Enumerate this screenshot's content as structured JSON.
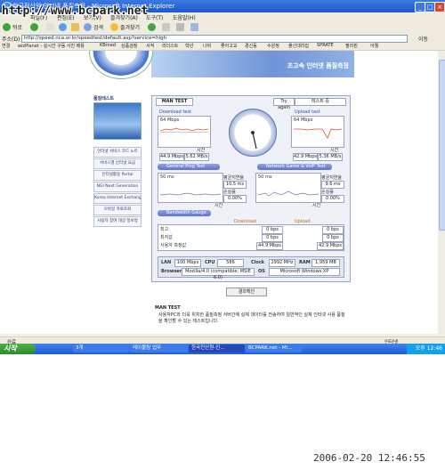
{
  "window": {
    "title": "한국전산원-인터넷 품질측정 - Microsoft Internet Explorer"
  },
  "watermark": "http://www.bcpark.net",
  "menu": [
    "파일(F)",
    "편집(E)",
    "보기(V)",
    "즐겨찾기(A)",
    "도구(T)",
    "도움말(H)"
  ],
  "toolbar": {
    "back": "뒤로",
    "search": "검색",
    "favorites": "즐겨찾기"
  },
  "address": {
    "label": "주소(D)",
    "url": "http://speed.nca.or.kr/speedtest/default.asp?service=high",
    "go": "이동"
  },
  "links": {
    "label": "연결",
    "items": [
      "wizPlanet - 실시간 구동 사진 배틀",
      "KBroad",
      "상품검정",
      "서적",
      "리더스트",
      "학년",
      "나비",
      "좋아고교",
      "경신동",
      "수원정",
      "플신대리집",
      "SPRATE",
      "필리핀",
      "아웰"
    ]
  },
  "banner": {
    "title": "초고속 인터넷 품질측정"
  },
  "sidebar": {
    "heading": "품질테스트",
    "items": [
      "인터넷 서비스 코드 노트",
      "서비스별 인터넷 요금",
      "인터넷활용 Portal",
      "NGI Next Generation",
      "Korea Internet Exchange",
      "모바일 자료조회",
      "사용자 참여 대상 정보방"
    ]
  },
  "test": {
    "tab": "MAN TEST",
    "try_again": "Try again",
    "field": "테스트 중",
    "download": {
      "title": "Download test",
      "unit": "Mbps",
      "scale": "64 Mbps",
      "value": "44.9 Mbps",
      "value2": "5.62 MB/s",
      "time": "시간"
    },
    "upload": {
      "title": "Upload test",
      "unit": "Mbps",
      "scale": "64 Mbps",
      "value": "42.9 Mbps",
      "value2": "5.36 MB/s",
      "time": "시간"
    },
    "ping": {
      "title": "General Ping Test",
      "scale": "50 ms",
      "avg_label": "평균지연율",
      "avg": "10.5 ms",
      "loss_label": "손실률",
      "loss": "0.00%",
      "time": "시간"
    },
    "nt": {
      "title": "Network Game & VoIP Test",
      "scale": "50 ms",
      "avg_label": "평균지연율",
      "avg": "9.6 ms",
      "loss_label": "손실률",
      "loss": "0.00%",
      "time": "시간"
    },
    "bandwidth": {
      "title": "Bandwidth Gauge"
    },
    "table": {
      "col_download": "Download",
      "col_upload": "Upload",
      "rows": [
        {
          "label": "최고",
          "d": "0 bps",
          "u": "0 bps"
        },
        {
          "label": "최저값",
          "d": "0 bps",
          "u": "0 bps"
        },
        {
          "label": "사용자 측정값",
          "d": "44.9 Mbps",
          "u": "42.9 Mbps"
        }
      ]
    },
    "sys": {
      "lan_label": "LAN",
      "lan": "100 Mbps",
      "cpu_label": "CPU",
      "cpu": "586",
      "clock_label": "Clock",
      "clock": "2992 MHz",
      "ram_label": "RAM",
      "ram": "1,959 MB",
      "browser_label": "Browser",
      "browser": "Mozilla/4.0 (compatible; MSIE 6.0)",
      "os_label": "OS",
      "os": "Microsoft Windows XP"
    },
    "result_button": "결과확인"
  },
  "info": {
    "heading": "MAN TEST",
    "text": "사용자PC와 더욱 위치한 품질측정 서버간에 실제 데이터를 전송하여 일반적인 실제 인터넷 사용 품질을 확인할 수 있는 테스트입니다."
  },
  "statusbar": {
    "left": "완료",
    "right": "인터넷"
  },
  "taskbar": {
    "start": "시작",
    "tasks": [
      "3개",
      "레이블링 업무",
      "한국전산원-인...",
      "BCPARK.net - Mi..."
    ],
    "clock": "오후 12:46"
  },
  "timestamp": "2006-02-20 12:46:55"
}
